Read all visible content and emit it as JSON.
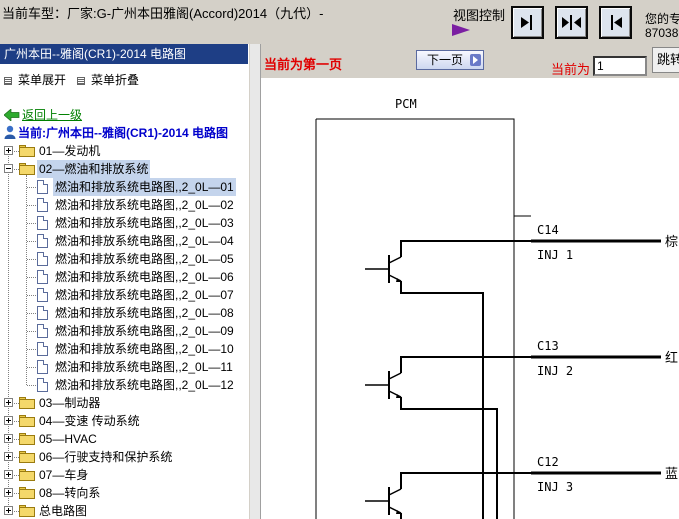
{
  "topbar": {
    "vehicle_title": "当前车型：厂家:G-广州本田雅阁(Accord)2014（九代）-",
    "view_control_label": "视图控制",
    "account_line1": "您的专",
    "account_line2": "87038"
  },
  "left_panel": {
    "header": "广州本田--雅阁(CR1)-2014 电路图",
    "expand_all": "菜单展开",
    "collapse_all": "菜单折叠",
    "back_link": "返回上一级",
    "current_node": "当前:广州本田--雅阁(CR1)-2014 电路图",
    "tree": [
      {
        "label": "01—发动机",
        "type": "folder",
        "expanded": false
      },
      {
        "label": "02—燃油和排放系统",
        "type": "folder",
        "expanded": true
      },
      {
        "label": "燃油和排放系统电路图,,2_0L—01",
        "type": "doc",
        "selected": true
      },
      {
        "label": "燃油和排放系统电路图,,2_0L—02",
        "type": "doc"
      },
      {
        "label": "燃油和排放系统电路图,,2_0L—03",
        "type": "doc"
      },
      {
        "label": "燃油和排放系统电路图,,2_0L—04",
        "type": "doc"
      },
      {
        "label": "燃油和排放系统电路图,,2_0L—05",
        "type": "doc"
      },
      {
        "label": "燃油和排放系统电路图,,2_0L—06",
        "type": "doc"
      },
      {
        "label": "燃油和排放系统电路图,,2_0L—07",
        "type": "doc"
      },
      {
        "label": "燃油和排放系统电路图,,2_0L—08",
        "type": "doc"
      },
      {
        "label": "燃油和排放系统电路图,,2_0L—09",
        "type": "doc"
      },
      {
        "label": "燃油和排放系统电路图,,2_0L—10",
        "type": "doc"
      },
      {
        "label": "燃油和排放系统电路图,,2_0L—11",
        "type": "doc"
      },
      {
        "label": "燃油和排放系统电路图,,2_0L—12",
        "type": "doc"
      },
      {
        "label": "03—制动器",
        "type": "folder",
        "expanded": false
      },
      {
        "label": "04—变速 传动系统",
        "type": "folder",
        "expanded": false
      },
      {
        "label": "05—HVAC",
        "type": "folder",
        "expanded": false
      },
      {
        "label": "06—行驶支持和保护系统",
        "type": "folder",
        "expanded": false
      },
      {
        "label": "07—车身",
        "type": "folder",
        "expanded": false
      },
      {
        "label": "08—转向系",
        "type": "folder",
        "expanded": false
      },
      {
        "label": "总电路图",
        "type": "folder",
        "expanded": false
      }
    ]
  },
  "right_panel": {
    "page_status": "当前为第一页",
    "next_page": "下一页",
    "current_label": "当前为",
    "page_value": "1",
    "jump_button": "跳转"
  },
  "diagram": {
    "module_label": "PCM",
    "connectors": [
      {
        "pin": "C14",
        "signal": "INJ 1",
        "wire_color": "棕"
      },
      {
        "pin": "C13",
        "signal": "INJ 2",
        "wire_color": "红"
      },
      {
        "pin": "C12",
        "signal": "INJ 3",
        "wire_color": "蓝"
      }
    ]
  },
  "colors": {
    "header_bg": "#1e3e85",
    "status_red": "#e00000",
    "link_green": "#008000",
    "node_blue": "#0000cc"
  }
}
